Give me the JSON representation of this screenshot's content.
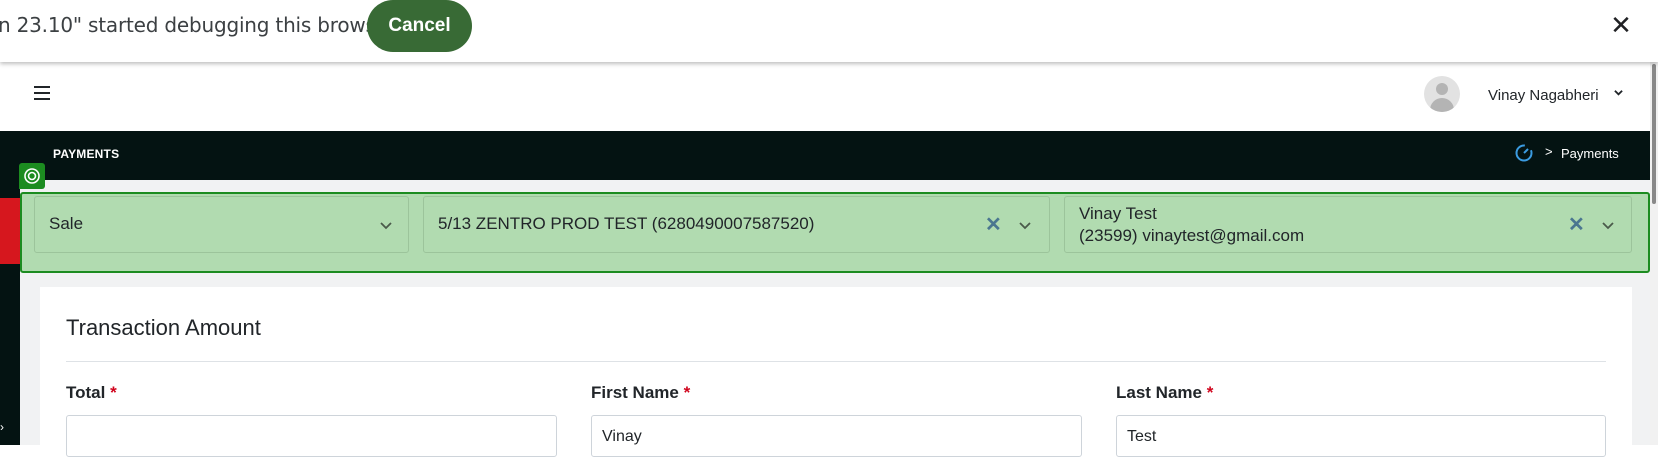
{
  "infobar": {
    "message": "n 23.10\" started debugging this browser",
    "cancel_label": "Cancel",
    "close_glyph": "✕"
  },
  "header": {
    "menu_icon": "hamburger-icon",
    "user_name": "Vinay Nagabheri",
    "avatar_icon": "user-avatar-icon"
  },
  "title_bar": {
    "page_title": "PAYMENTS",
    "breadcrumb_separator": ">",
    "breadcrumb_current": "Payments"
  },
  "filters": {
    "type": {
      "value": "Sale"
    },
    "terminal": {
      "value": "5/13 ZENTRO PROD TEST (6280490007587520)",
      "clear_glyph": "✕"
    },
    "customer": {
      "line1": "Vinay Test",
      "line2": "(23599) vinaytest@gmail.com",
      "clear_glyph": "✕"
    }
  },
  "card": {
    "title": "Transaction Amount",
    "fields": [
      {
        "label": "Total",
        "required_mark": "*",
        "value": ""
      },
      {
        "label": "First Name",
        "required_mark": "*",
        "value": "Vinay"
      },
      {
        "label": "Last Name",
        "required_mark": "*",
        "value": "Test"
      }
    ]
  },
  "colors": {
    "accent_green": "#386a35",
    "highlight_green": "#b1dbb0",
    "highlight_border": "#1c8c20",
    "dark_bar": "#041312",
    "rail_red": "#d6171e",
    "required_red": "#d0021b",
    "clear_blue": "#4a7690"
  }
}
